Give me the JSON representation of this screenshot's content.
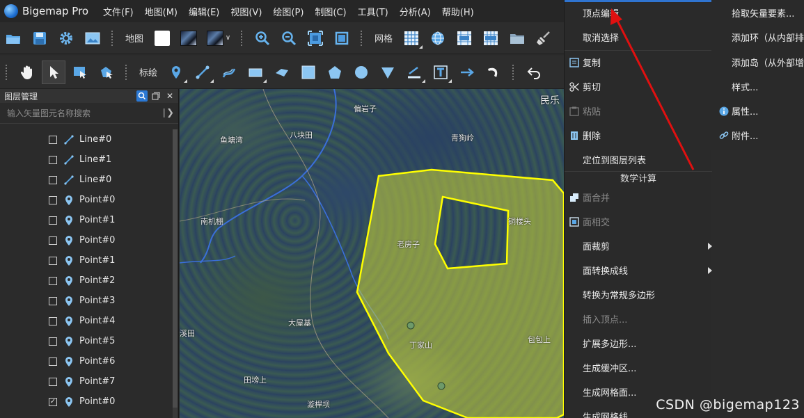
{
  "app": {
    "title": "Bigemap Pro",
    "menu": [
      "文件(F)",
      "地图(M)",
      "编辑(E)",
      "视图(V)",
      "绘图(P)",
      "制图(C)",
      "工具(T)",
      "分析(A)",
      "帮助(H)"
    ]
  },
  "toolbar1": {
    "map_label": "地图",
    "grid_label": "网格"
  },
  "toolbar2": {
    "mark_label": "标绘"
  },
  "layers": {
    "title": "图层管理",
    "search_placeholder": "输入矢量图元名称搜索",
    "items": [
      {
        "name": "Line#0",
        "kind": "line",
        "checked": false
      },
      {
        "name": "Line#1",
        "kind": "line",
        "checked": false
      },
      {
        "name": "Line#0",
        "kind": "line",
        "checked": false
      },
      {
        "name": "Point#0",
        "kind": "point",
        "checked": false
      },
      {
        "name": "Point#1",
        "kind": "point",
        "checked": false
      },
      {
        "name": "Point#0",
        "kind": "point",
        "checked": false
      },
      {
        "name": "Point#1",
        "kind": "point",
        "checked": false
      },
      {
        "name": "Point#2",
        "kind": "point",
        "checked": false
      },
      {
        "name": "Point#3",
        "kind": "point",
        "checked": false
      },
      {
        "name": "Point#4",
        "kind": "point",
        "checked": false
      },
      {
        "name": "Point#5",
        "kind": "point",
        "checked": false
      },
      {
        "name": "Point#6",
        "kind": "point",
        "checked": false
      },
      {
        "name": "Point#7",
        "kind": "point",
        "checked": false
      },
      {
        "name": "Point#0",
        "kind": "point",
        "checked": true
      }
    ]
  },
  "map_labels": [
    "偏岩子",
    "鱼塘湾",
    "八块田",
    "青狗岭",
    "南机棚",
    "老房子",
    "铜楼头",
    "大屋基",
    "丁家山",
    "包包上",
    "田塝上",
    "漩桿坝",
    "民乐",
    "溪田"
  ],
  "context_menu": {
    "items": [
      "顶点编辑",
      "取消选择",
      "复制",
      "剪切",
      "粘贴",
      "删除",
      "定位到图层列表",
      "面合并",
      "面相交",
      "面裁剪",
      "面转换成线",
      "转换为常规多边形",
      "插入顶点...",
      "扩展多边形...",
      "生成缓冲区...",
      "生成网格面...",
      "生成网格线..."
    ],
    "section_title": "数学计算"
  },
  "context_menu2": {
    "items": [
      "拾取矢量要素...",
      "添加环（从内部排",
      "添加岛（从外部增",
      "样式...",
      "属性...",
      "附件..."
    ]
  },
  "watermark": "CSDN @bigemap123",
  "colors": {
    "polygon_stroke": "#ffff00",
    "polygon_fill": "#c8d23a",
    "accent_blue": "#2a78d4",
    "arrow_red": "#e01010"
  }
}
